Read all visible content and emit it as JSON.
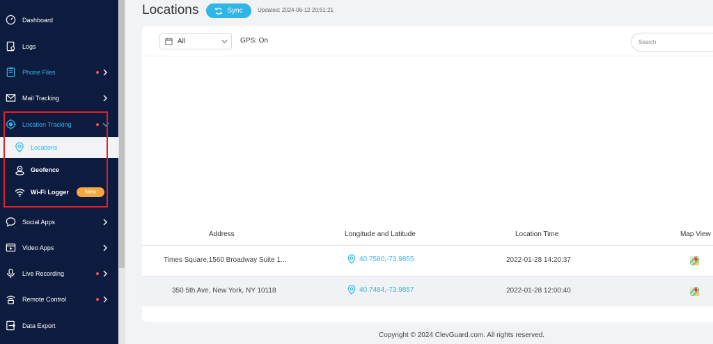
{
  "sidebar": {
    "items": [
      {
        "label": "Dashboard",
        "icon": "dashboard-icon"
      },
      {
        "label": "Logs",
        "icon": "logs-icon"
      },
      {
        "label": "Phone Files",
        "icon": "phone-files-icon",
        "dot": true,
        "chevron": true
      },
      {
        "label": "Mail Tracking",
        "icon": "mail-icon",
        "chevron": true
      },
      {
        "label": "Location Tracking",
        "icon": "location-target-icon",
        "dot": true,
        "expanded": true
      },
      {
        "label": "Social Apps",
        "icon": "chat-bubble-icon",
        "chevron": true
      },
      {
        "label": "Video Apps",
        "icon": "video-icon",
        "chevron": true
      },
      {
        "label": "Live Recording",
        "icon": "microphone-icon",
        "dot": true,
        "chevron": true
      },
      {
        "label": "Remote Control",
        "icon": "remote-control-icon",
        "dot": true,
        "chevron": true
      },
      {
        "label": "Data Export",
        "icon": "export-icon"
      }
    ],
    "sub_items": [
      {
        "label": "Locations",
        "icon": "location-pin-icon"
      },
      {
        "label": "Geofence",
        "icon": "geofence-icon"
      },
      {
        "label": "Wi-Fi Logger",
        "icon": "wifi-icon",
        "badge": "New"
      }
    ]
  },
  "header": {
    "title": "Locations",
    "sync_label": "Sync",
    "updated": "Updated: 2024-06-12 20:51:21"
  },
  "filter": {
    "selected": "All",
    "gps": "GPS: On",
    "search_placeholder": "Search"
  },
  "table": {
    "columns": [
      "Address",
      "Longitude and Latitude",
      "Location Time",
      "Map View"
    ],
    "rows": [
      {
        "address": "Times Square,1560 Broadway Suite 1...",
        "coords": "40.7580,-73.9855",
        "time": "2022-01-28 14:20:37"
      },
      {
        "address": "350 5th Ave, New York, NY 10118",
        "coords": "40.7484,-73.9857",
        "time": "2022-01-28 12:00:40"
      }
    ]
  },
  "footer": {
    "copyright": "Copyright © 2024 ClevGuard.com. All rights reserved."
  },
  "colors": {
    "sidebar_bg": "#0d1b3e",
    "accent": "#2fb6e6",
    "dot": "#ff4d4f",
    "badge": "#f5a742",
    "highlight": "#e0202a"
  }
}
